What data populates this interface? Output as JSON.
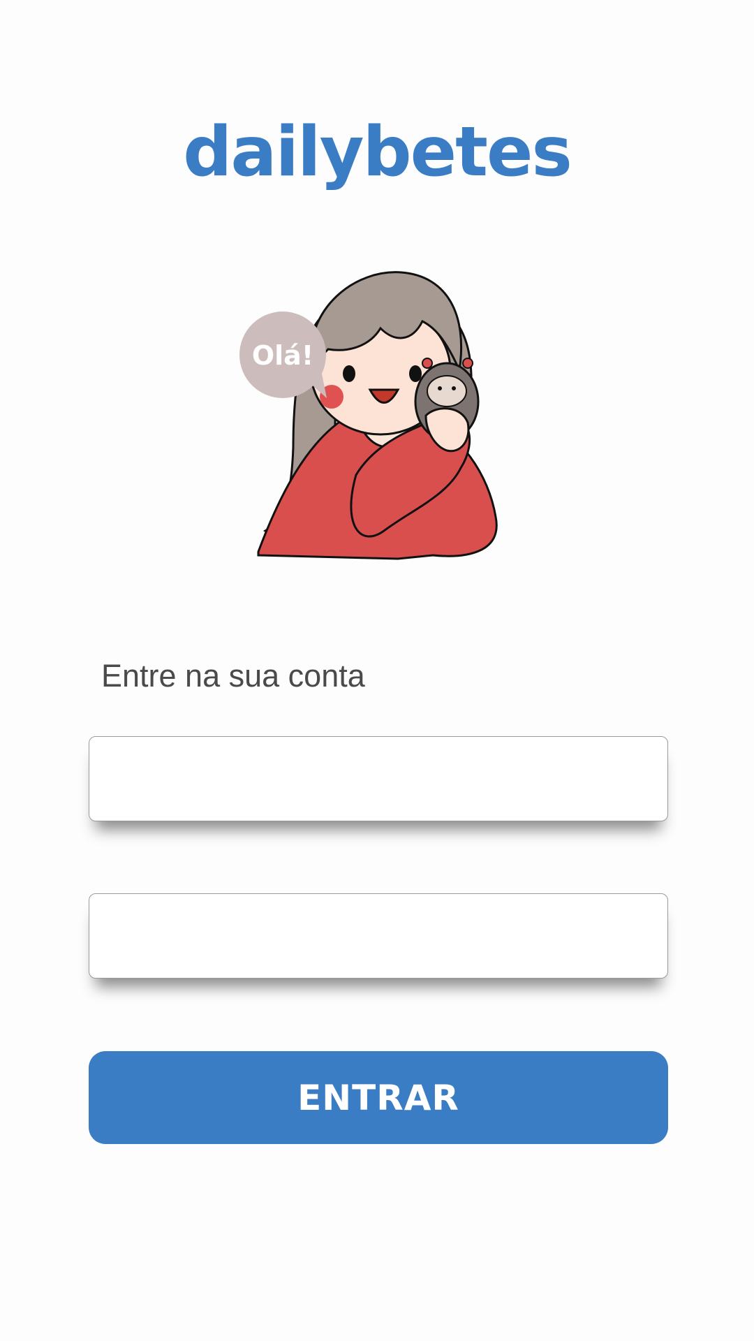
{
  "app": {
    "logo": "dailybetes"
  },
  "illustration": {
    "speech_bubble": "Olá!",
    "bubble_color": "#cdbcbc",
    "hair_color": "#a79a93",
    "sweater_color": "#d94f4e"
  },
  "login": {
    "prompt": "Entre na sua conta",
    "email_value": "",
    "email_placeholder": "",
    "password_value": "",
    "password_placeholder": "",
    "submit_label": "ENTRAR"
  },
  "colors": {
    "brand": "#3a7dc5",
    "background": "#fdfdfd",
    "text": "#4a4a4a"
  }
}
